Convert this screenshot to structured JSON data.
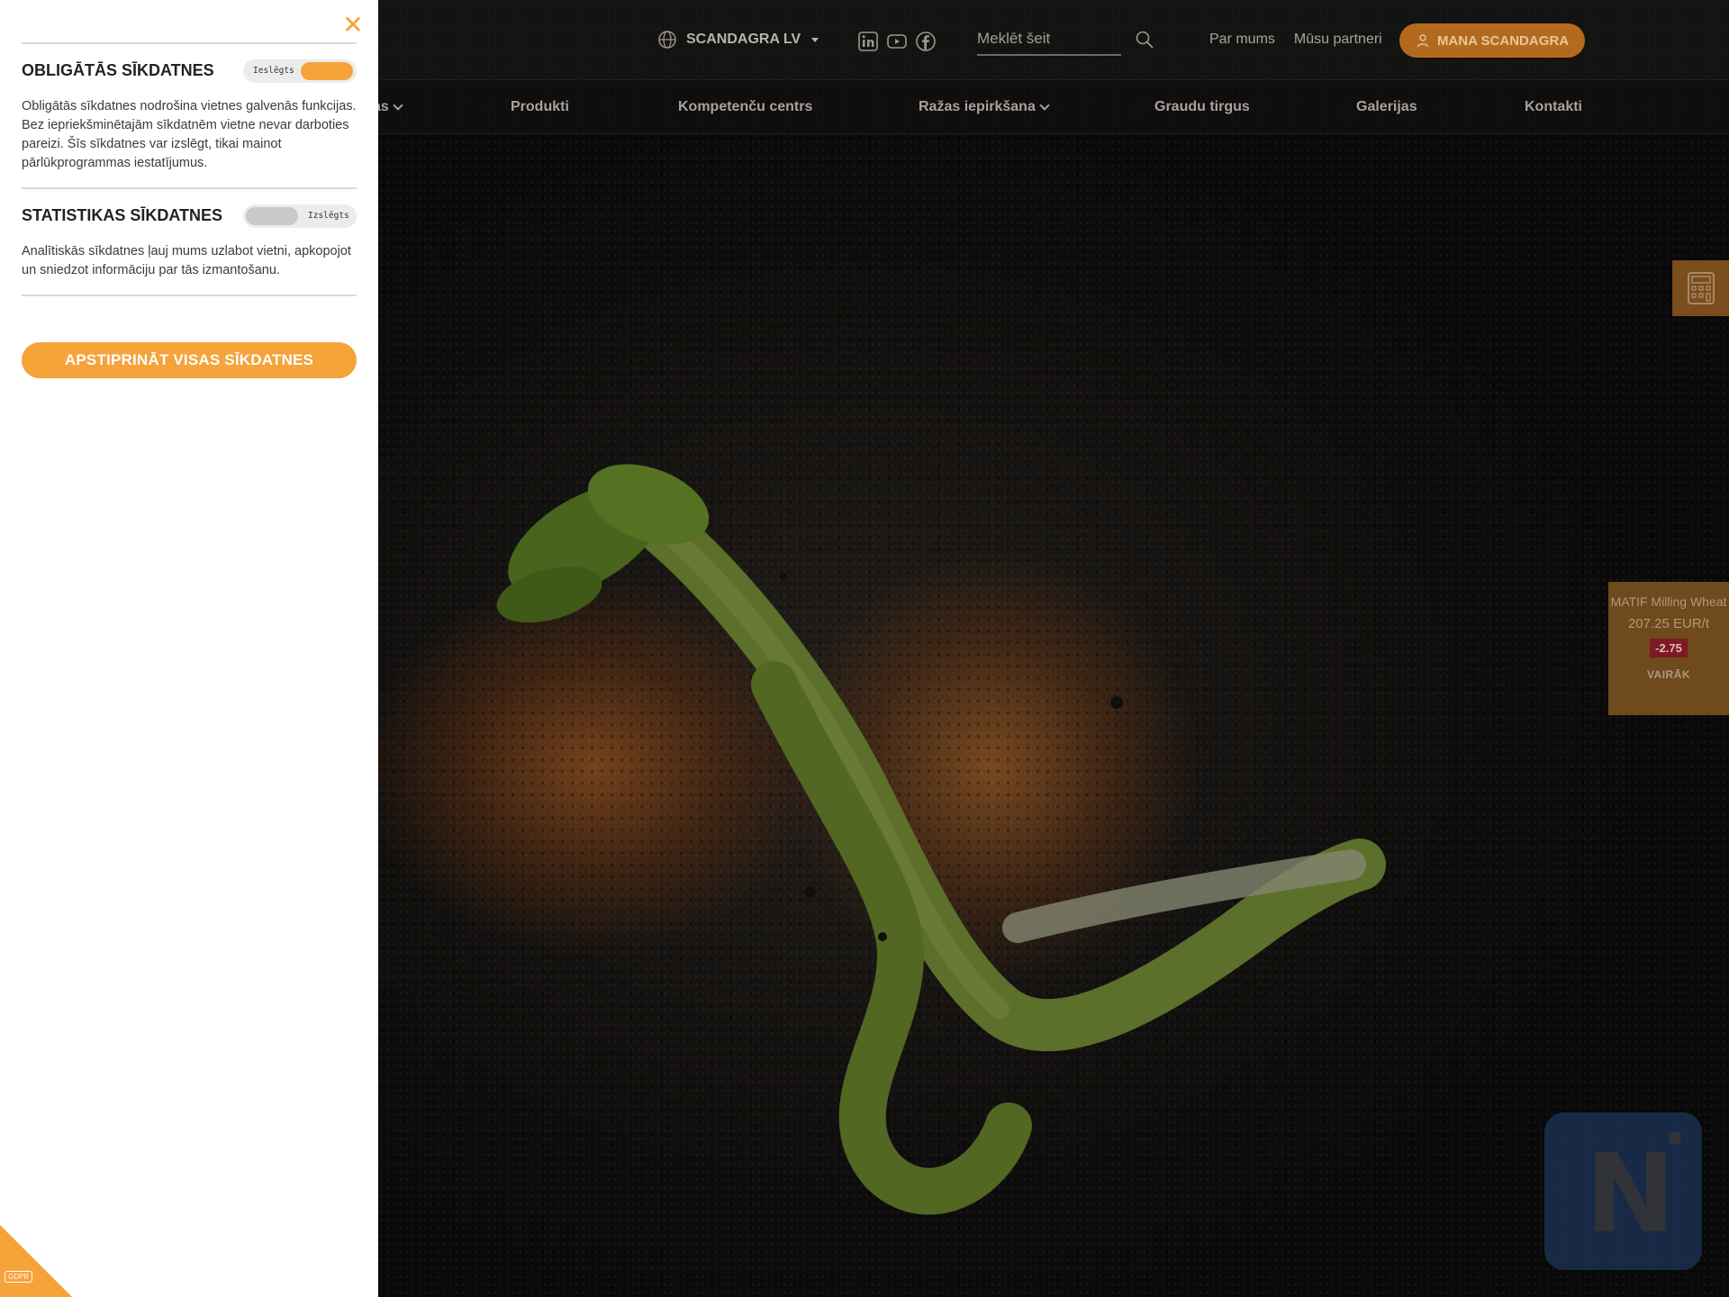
{
  "header": {
    "language_label": "SCANDAGRA LV",
    "social": [
      {
        "icon": "linkedin-icon"
      },
      {
        "icon": "youtube-icon"
      },
      {
        "icon": "facebook-icon"
      }
    ],
    "search_placeholder": "Meklēt šeit",
    "links": [
      "Par mums",
      "Mūsu partneri"
    ],
    "account_button": "MANA SCANDAGRA"
  },
  "main_nav": {
    "partial_item": "as",
    "items": [
      "Produkti",
      "Kompetenču centrs",
      "Ražas iepirkšana",
      "Graudu tirgus",
      "Galerijas",
      "Kontakti"
    ]
  },
  "price_widget": {
    "name": "MATIF Milling Wheat",
    "value": "207.25 EUR/t",
    "change": "-2.75",
    "more": "VAIRĀK"
  },
  "cookie_panel": {
    "close_icon": "close-icon",
    "sections": [
      {
        "title": "OBLIGĀTĀS SĪKDATNES",
        "toggle_label": "Ieslēgts",
        "enabled": true,
        "text": "Obligātās sīkdatnes nodrošina vietnes galvenās funkcijas. Bez iepriekšminētajām sīkdatnēm vietne nevar darboties pareizi. Šīs sīkdatnes var izslēgt, tikai mainot pārlūkprogrammas iestatījumus."
      },
      {
        "title": "STATISTIKAS SĪKDATNES",
        "toggle_label": "Izslēgts",
        "enabled": false,
        "text": "Analītiskās sīkdatnes ļauj mums uzlabot vietni, apkopojot un sniedzot informāciju par tās izmantošanu."
      }
    ],
    "accept_button": "APSTIPRINĀT VISAS SĪKDATNES"
  },
  "gdpr_badge": "GDPR",
  "colors": {
    "accent": "#f6a33a",
    "negative_change": "#7c1b22"
  }
}
